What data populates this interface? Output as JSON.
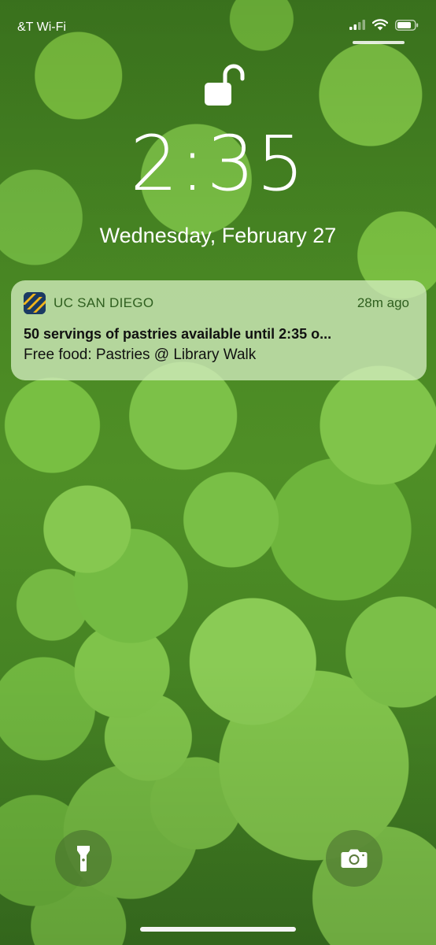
{
  "status_bar": {
    "carrier": "&T Wi-Fi",
    "signal_icon": "cellular-signal-icon",
    "wifi_icon": "wifi-icon",
    "battery_icon": "battery-icon"
  },
  "lock": {
    "icon": "unlocked-padlock-icon"
  },
  "clock": {
    "time": "2:35"
  },
  "date": {
    "text": "Wednesday, February 27"
  },
  "notification": {
    "app_name": "UC SAN DIEGO",
    "time_ago": "28m ago",
    "title": "50 servings of pastries available until 2:35 o...",
    "body": "Free food: Pastries @ Library Walk",
    "app_icon": "uc-san-diego-app-icon",
    "app_icon_colors": {
      "navy": "#1b3a63",
      "gold": "#f2b51b"
    }
  },
  "quick_actions": {
    "flashlight_icon": "flashlight-icon",
    "camera_icon": "camera-icon"
  }
}
